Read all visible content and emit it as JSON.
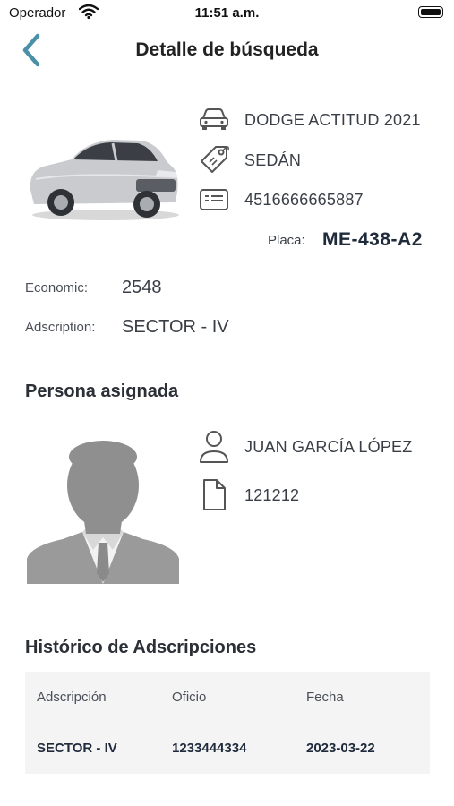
{
  "status_bar": {
    "carrier": "Operador",
    "time": "11:51 a.m.",
    "icons": [
      "wifi-icon",
      "battery-icon"
    ]
  },
  "nav": {
    "back_icon": "chevron-left-icon",
    "title": "Detalle de búsqueda",
    "accent_color": "#4a90a8"
  },
  "vehicle": {
    "model": "DODGE ACTITUD 2021",
    "type": "SEDÁN",
    "serial": "4516666665887",
    "plate_label": "Placa:",
    "plate": "ME-438-A2",
    "economic_label": "Economic:",
    "economic": "2548",
    "adscription_label": "Adscription:",
    "adscription": "SECTOR - IV",
    "icons": [
      "car-icon",
      "tag-icon",
      "id-card-icon"
    ]
  },
  "person": {
    "section_title": "Persona asignada",
    "name": "JUAN GARCÍA LÓPEZ",
    "document": "121212",
    "icons": [
      "user-icon",
      "document-icon"
    ]
  },
  "history": {
    "section_title": "Histórico de Adscripciones",
    "columns": [
      "Adscripción",
      "Oficio",
      "Fecha"
    ],
    "rows": [
      [
        "SECTOR - IV",
        "1233444334",
        "2023-03-22"
      ]
    ]
  }
}
